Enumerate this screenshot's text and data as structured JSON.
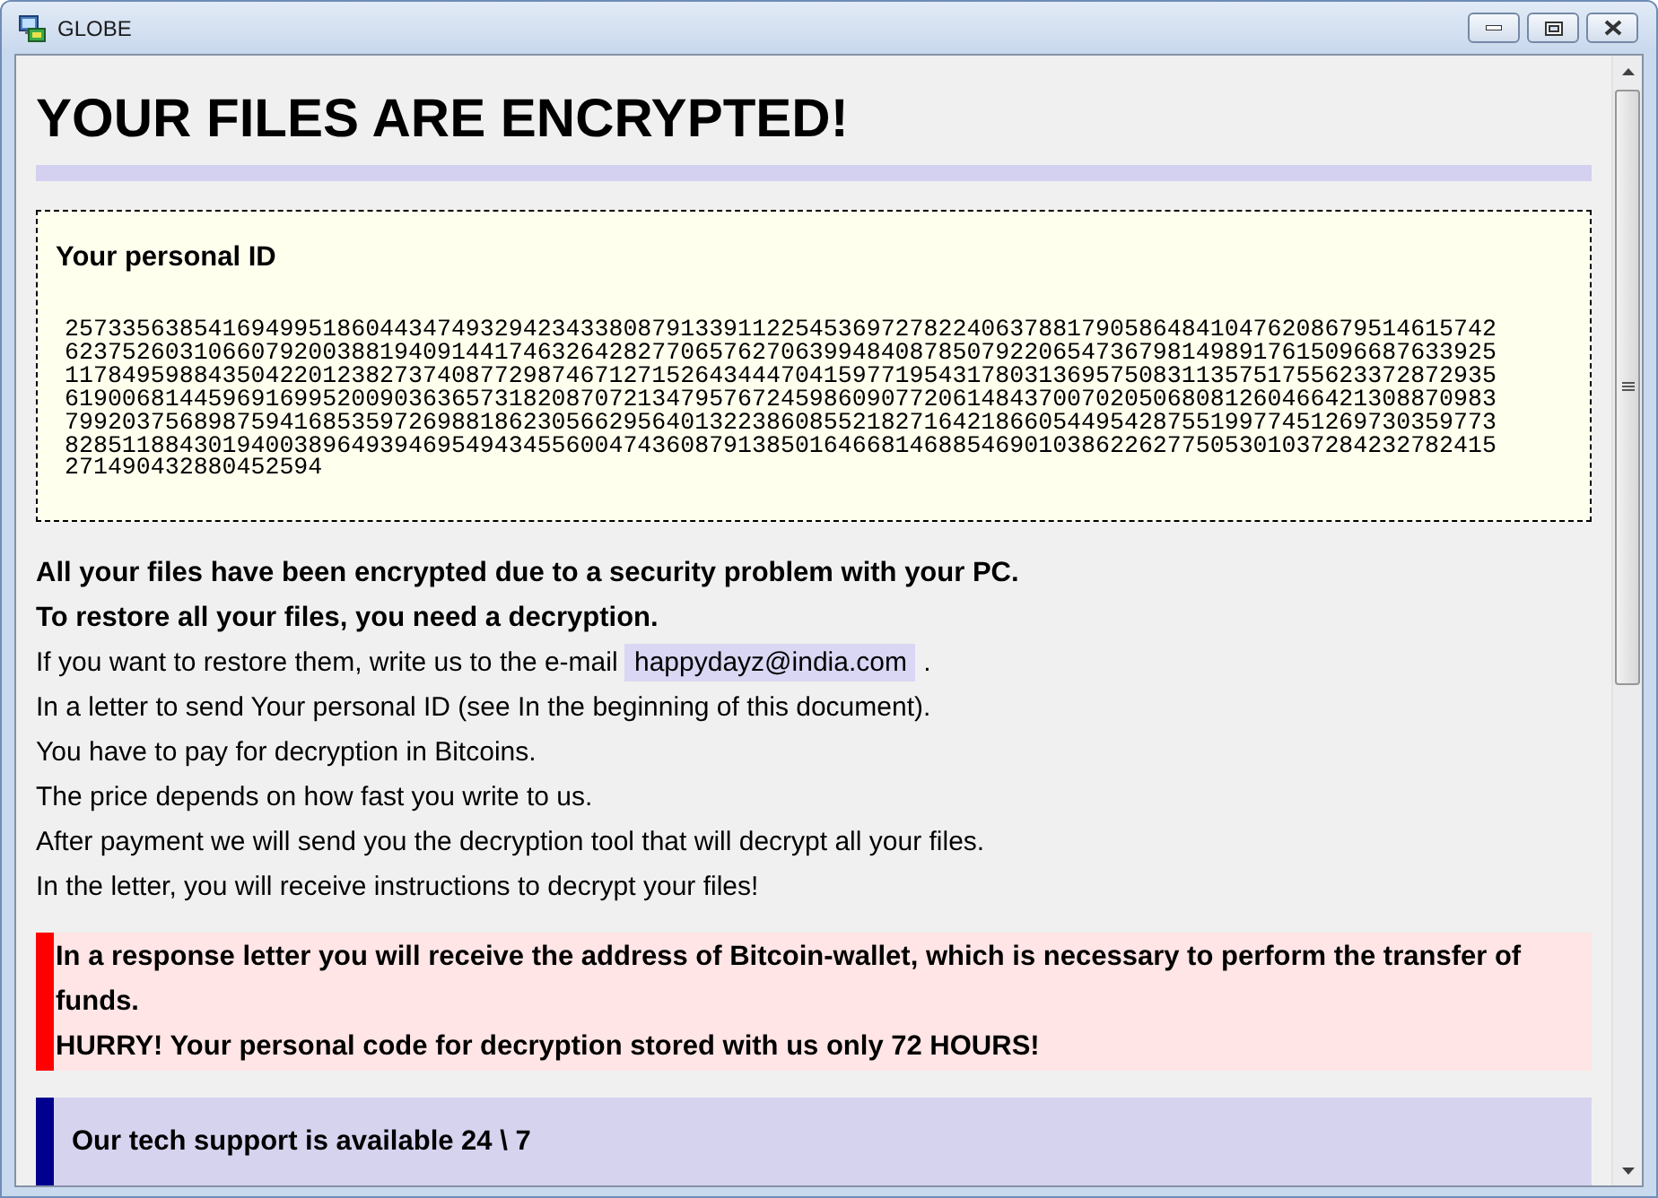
{
  "window": {
    "title": "GLOBE"
  },
  "heading": "YOUR FILES ARE ENCRYPTED!",
  "id_panel": {
    "title": "Your personal ID",
    "id": "257335638541694995186044347493294234338087913391122545369727822406378817905864841047620867951461574262375260310660792003881940914417463264282770657627063994840878507922065473679814989176150966876339251178495988435042201238273740877298746712715264344470415977195431780313695750831135751755623372872935619006814459691699520090363657318208707213479576724598609077206148437007020506808126046642130887098379920375689875941685359726988186230566295640132238608552182716421866054495428755199774512697303597738285118843019400389649394695494345560047436087913850164668146885469010386226277505301037284232782415271490432880452594"
  },
  "message": [
    {
      "kind": "bold",
      "text": "All your files have been encrypted due to a security problem with your PC."
    },
    {
      "kind": "bold",
      "text": "To restore all your files, you need a decryption."
    },
    {
      "kind": "email",
      "before": "If you want to restore them, write us to the e-mail",
      "email": "happydayz@india.com",
      "after": "."
    },
    {
      "kind": "plain",
      "text": "In a letter to send Your personal ID (see In the beginning of this document)."
    },
    {
      "kind": "plain",
      "text": "You have to pay for decryption in Bitcoins."
    },
    {
      "kind": "plain",
      "text": "The price depends on how fast you write to us."
    },
    {
      "kind": "plain",
      "text": "After payment we will send you the decryption tool that will decrypt all your files."
    },
    {
      "kind": "plain",
      "text": "In the letter, you will receive instructions to decrypt your files!"
    }
  ],
  "alert": {
    "lines": [
      "In a response letter you will receive the address of Bitcoin-wallet, which is necessary to perform the transfer of funds.",
      "HURRY! Your personal code for decryption stored with us only 72 HOURS!"
    ]
  },
  "support": {
    "title": "Our tech support is available 24 \\ 7"
  }
}
